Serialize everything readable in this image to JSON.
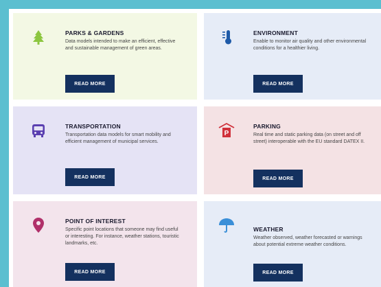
{
  "cards": [
    {
      "title": "PARKS & GARDENS",
      "description": "Data models intended to make an efficient, effective and sustainable management of green areas.",
      "button": "READ MORE",
      "icon": "tree-icon",
      "icon_color": "#8cc63f"
    },
    {
      "title": "ENVIRONMENT",
      "description": "Enable to monitor air quality and other environmental conditions for a healthier living.",
      "button": "READ MORE",
      "icon": "thermometer-icon",
      "icon_color": "#1e5aa8"
    },
    {
      "title": "TRANSPORTATION",
      "description": "Transportation data models for smart mobility and efficient management of municipal services.",
      "button": "READ MORE",
      "icon": "bus-icon",
      "icon_color": "#5a3fb0"
    },
    {
      "title": "PARKING",
      "description": "Real time and static parking data (on street and off street) interoperable with the EU standard DATEX II.",
      "button": "READ MORE",
      "icon": "parking-icon",
      "icon_color": "#d0303a"
    },
    {
      "title": "POINT OF INTEREST",
      "description": "Specific point locations that someone may find useful or interesting. For instance, weather stations, touristic landmarks, etc.",
      "button": "READ MORE",
      "icon": "map-pin-icon",
      "icon_color": "#b0306a"
    },
    {
      "title": "WEATHER",
      "description": "Weather observed, weather forecasted or warnings about potential extreme weather conditions.",
      "button": "READ MORE",
      "icon": "umbrella-icon",
      "icon_color": "#3a8fd8"
    }
  ],
  "colors": {
    "page_background": "#5bbfd0",
    "button": "#14315f"
  }
}
